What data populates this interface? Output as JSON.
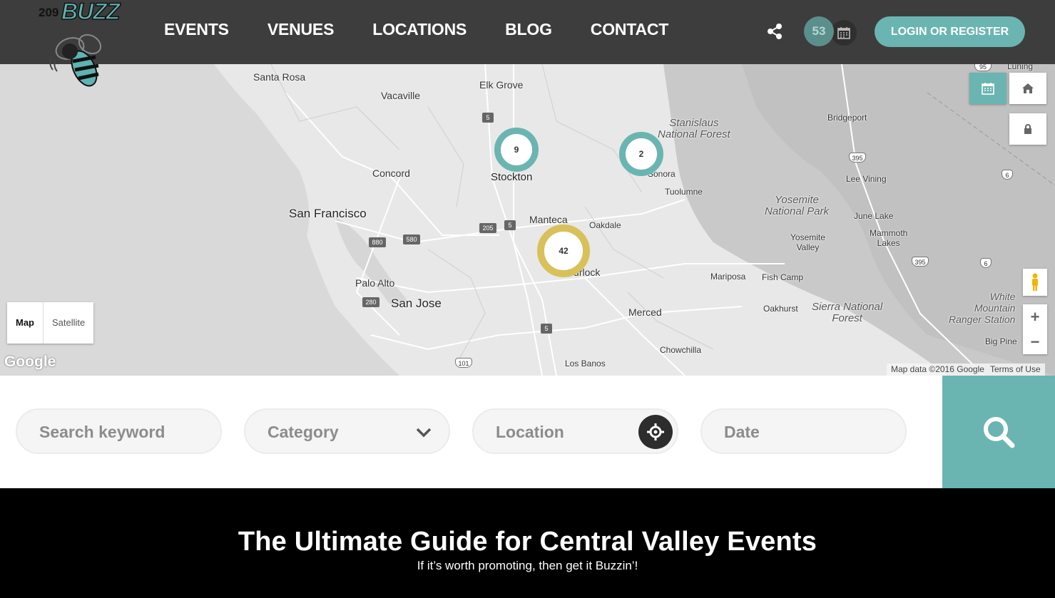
{
  "header": {
    "logo": {
      "number": "209",
      "name": "BUZZ"
    },
    "nav": [
      "EVENTS",
      "VENUES",
      "LOCATIONS",
      "BLOG",
      "CONTACT"
    ],
    "events_count": "53",
    "login_label": "LOGIN OR REGISTER"
  },
  "map": {
    "places": {
      "santa_rosa": "Santa Rosa",
      "vacaville": "Vacaville",
      "elk_grove": "Elk Grove",
      "stanislaus": "Stanislaus\nNational Forest",
      "bridgeport": "Bridgeport",
      "concord": "Concord",
      "stockton": "Stockton",
      "sonora": "Sonora",
      "tuolumne": "Tuolumne",
      "lee_vining": "Lee Vining",
      "yosemite_np": "Yosemite\nNational Park",
      "san_francisco": "San Francisco",
      "manteca": "Manteca",
      "oakdale": "Oakdale",
      "june_lake": "June Lake",
      "mammoth": "Mammoth\nLakes",
      "yosemite_valley": "Yosemite\nValley",
      "turlock": "Turlock",
      "mariposa": "Mariposa",
      "fish_camp": "Fish Camp",
      "palo_alto": "Palo Alto",
      "san_jose": "San Jose",
      "white_mountain": "White\nMountain\nRanger Station",
      "oakhurst": "Oakhurst",
      "sierra_nf": "Sierra National\nForest",
      "merced": "Merced",
      "big_pine": "Big Pine",
      "chowchilla": "Chowchilla",
      "los_banos": "Los Banos",
      "luning": "Luning"
    },
    "roads": [
      "5",
      "205",
      "5",
      "880",
      "580",
      "280",
      "5",
      "101",
      "395",
      "6",
      "395",
      "6",
      "95"
    ],
    "clusters": [
      {
        "count": "9",
        "color": "#6ab5b1"
      },
      {
        "count": "2",
        "color": "#6ab5b1"
      },
      {
        "count": "42",
        "color": "#d8c15a"
      }
    ],
    "map_type": {
      "map": "Map",
      "satellite": "Satellite"
    },
    "google": "Google",
    "attribution": "Map data ©2016 Google",
    "terms": "Terms of Use",
    "zoom_in": "+",
    "zoom_out": "−"
  },
  "search": {
    "keyword_placeholder": "Search keyword",
    "category_placeholder": "Category",
    "location_placeholder": "Location",
    "date_placeholder": "Date"
  },
  "banner": {
    "title": "The Ultimate Guide for Central Valley Events",
    "subtitle": "If it’s worth promoting, then get it Buzzin’!"
  },
  "colors": {
    "accent": "#6ab5b1",
    "header": "#3d3d3d",
    "cluster_big": "#d8c15a"
  }
}
